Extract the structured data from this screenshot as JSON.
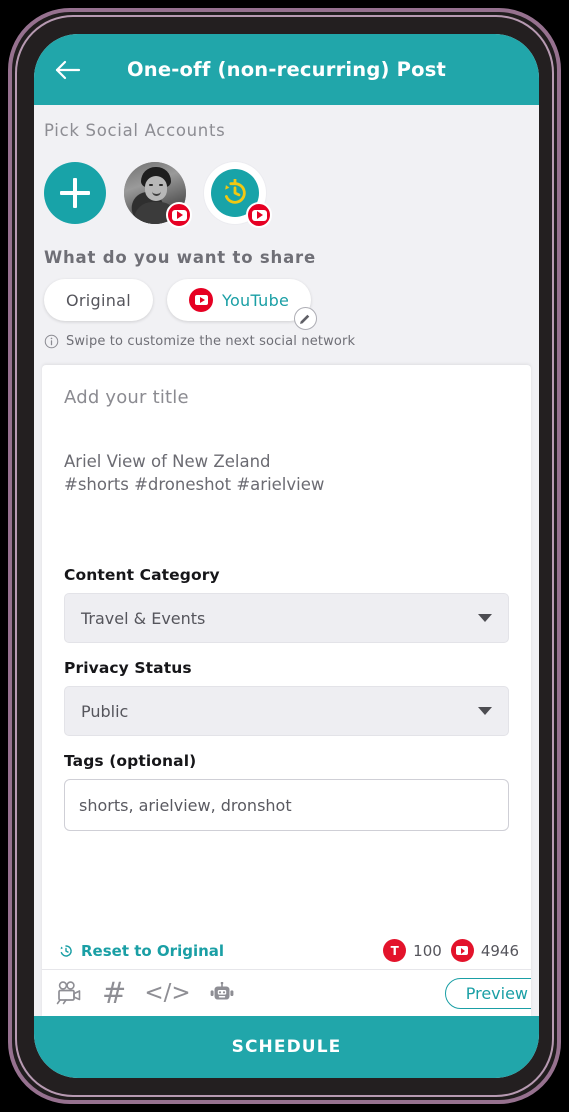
{
  "header": {
    "title": "One-off (non-recurring) Post",
    "back_icon": "arrow-left-icon",
    "bg_color": "#21a6aa"
  },
  "accounts": {
    "section_label": "Pick Social Accounts",
    "add_button_icon": "plus-icon",
    "items": [
      {
        "type": "add",
        "name": "add-account"
      },
      {
        "type": "avatar",
        "name": "user-avatar",
        "badge": "youtube-icon"
      },
      {
        "type": "history",
        "name": "history-account",
        "badge": "youtube-icon",
        "icon": "history-icon"
      }
    ]
  },
  "share": {
    "question": "What do you want to share",
    "chips": [
      {
        "label": "Original",
        "active": false
      },
      {
        "label": "YouTube",
        "active": true,
        "icon": "youtube-icon",
        "edit_icon": "pencil-icon"
      }
    ],
    "hint": "Swipe to customize the next social network",
    "hint_icon": "info-icon"
  },
  "compose": {
    "title_placeholder": "Add your title",
    "body_text": "Ariel View of New Zeland\n#shorts #droneshot #arielview",
    "fields": {
      "category_label": "Content Category",
      "category_value": "Travel & Events",
      "privacy_label": "Privacy Status",
      "privacy_value": "Public",
      "tags_label": "Tags (optional)",
      "tags_value": "shorts, arielview, dronshot"
    }
  },
  "footer": {
    "reset_label": "Reset to Original",
    "reset_icon": "restore-icon",
    "counters": [
      {
        "badge": "T",
        "value": "100"
      },
      {
        "badge": "youtube-icon",
        "value": "4946"
      }
    ],
    "toolbar": [
      {
        "name": "video-camera-icon"
      },
      {
        "name": "hashtag-icon",
        "glyph": "#"
      },
      {
        "name": "code-icon",
        "glyph": "</>"
      },
      {
        "name": "robot-icon"
      }
    ],
    "preview_label": "Preview",
    "schedule_label": "SCHEDULE"
  },
  "colors": {
    "teal": "#21a6aa",
    "red": "#e60023",
    "grey_bg": "#f1f1f4"
  }
}
